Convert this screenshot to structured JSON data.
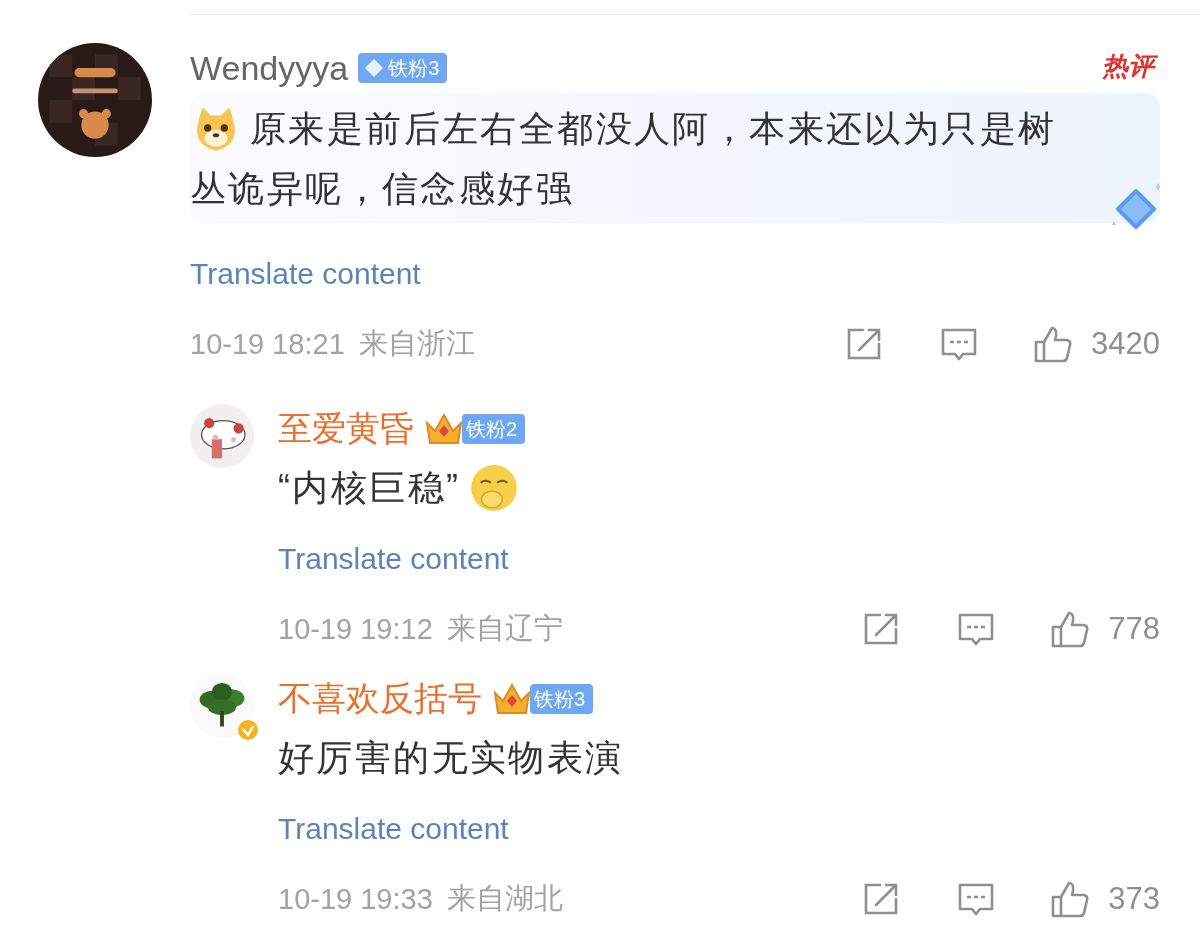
{
  "comment": {
    "username": "Wendyyya",
    "badge": {
      "kind": "diamond",
      "label": "铁粉3"
    },
    "hot_label": "热评",
    "emoji_before": {
      "kind": "doge"
    },
    "text_lines": [
      "原来是前后左右全都没人阿，本来还以为只是树",
      "丛诡异呢，信念感好强"
    ],
    "translate": "Translate content",
    "time": "10-19 18:21",
    "location": "来自浙江",
    "likes": "3420"
  },
  "replies": [
    {
      "verified": false,
      "username": "至爱黄昏",
      "badge": {
        "kind": "crown",
        "label": "铁粉2"
      },
      "emoji_after": {
        "kind": "covering-mouth"
      },
      "text": "“内核巨稳”",
      "translate": "Translate content",
      "time": "10-19 19:12",
      "location": "来自辽宁",
      "likes": "778"
    },
    {
      "verified": true,
      "username": "不喜欢反括号",
      "badge": {
        "kind": "crown",
        "label": "铁粉3"
      },
      "text": "好厉害的无实物表演",
      "translate": "Translate content",
      "time": "10-19 19:33",
      "location": "来自湖北",
      "likes": "373"
    }
  ]
}
